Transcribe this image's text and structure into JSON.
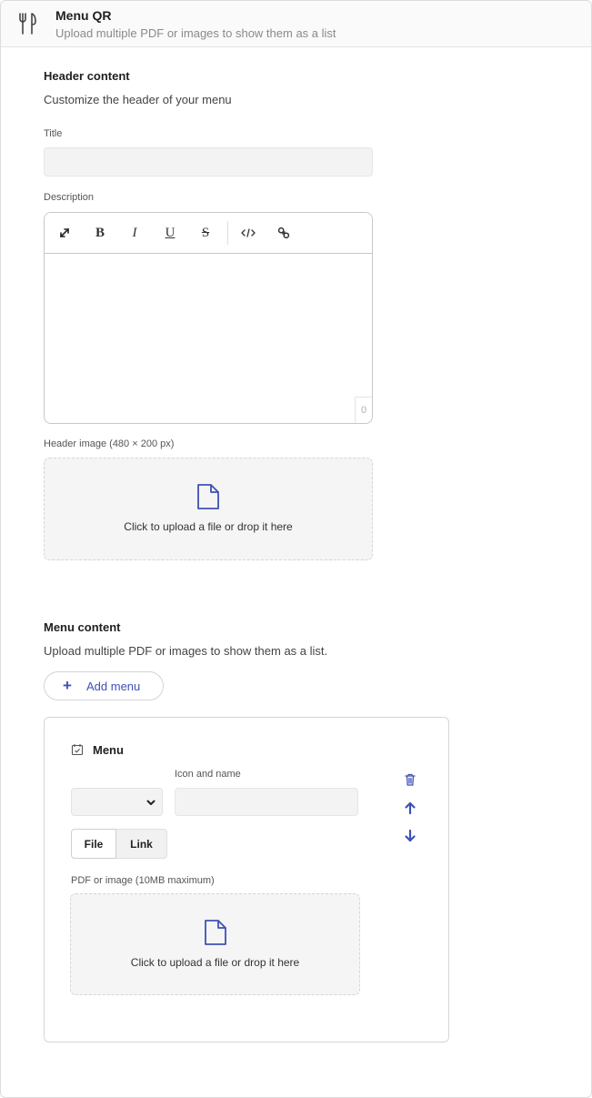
{
  "header": {
    "title": "Menu QR",
    "subtitle": "Upload multiple PDF or images to show them as a list",
    "icon": "fork-knife-icon"
  },
  "header_content": {
    "title": "Header content",
    "description": "Customize the header of your menu",
    "title_label": "Title",
    "title_value": "",
    "description_label": "Description",
    "editor_toolbar": [
      "expand-icon",
      "bold-icon",
      "italic-icon",
      "underline-icon",
      "strikethrough-icon",
      "code-icon",
      "link-icon"
    ],
    "char_count": "0",
    "image_label": "Header image (480 × 200 px)",
    "upload_text": "Click to upload a file or drop it here"
  },
  "menu_content": {
    "title": "Menu content",
    "description": "Upload multiple PDF or images to show them as a list.",
    "add_button": "Add menu",
    "card": {
      "heading": "Menu",
      "icon_name_label": "Icon and name",
      "name_value": "",
      "tabs": [
        "File",
        "Link"
      ],
      "active_tab": "File",
      "file_label": "PDF or image (10MB maximum)",
      "upload_text": "Click to upload a file or drop it here"
    }
  },
  "colors": {
    "accent": "#3f51b5",
    "input_bg": "#f3f3f3",
    "border": "#d6d6d6"
  }
}
